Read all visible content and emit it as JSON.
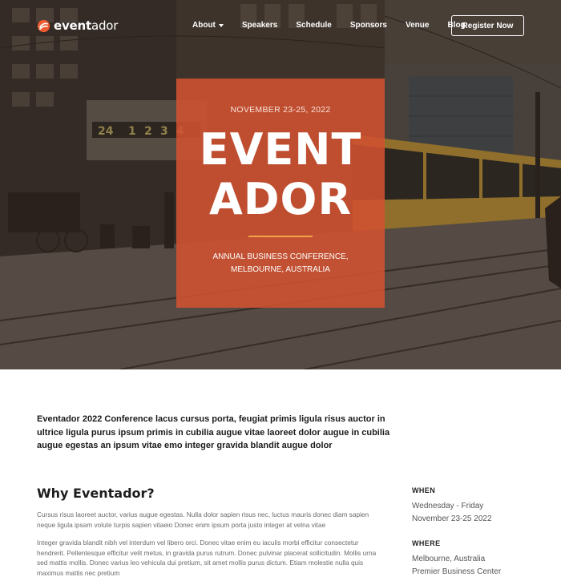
{
  "brand": {
    "name_bold": "event",
    "name_light": "ador",
    "accent": "#ee5a2f"
  },
  "nav": {
    "items": [
      {
        "label": "About",
        "has_dropdown": true
      },
      {
        "label": "Speakers"
      },
      {
        "label": "Schedule"
      },
      {
        "label": "Sponsors"
      },
      {
        "label": "Venue"
      },
      {
        "label": "Blog"
      }
    ],
    "register_label": "Register Now"
  },
  "hero": {
    "date": "NOVEMBER 23-25, 2022",
    "title_line1": "EVENT",
    "title_line2": "ADOR",
    "subtitle_line1": "ANNUAL BUSINESS CONFERENCE,",
    "subtitle_line2": "MELBOURNE, AUSTRALIA",
    "card_color": "#d15231",
    "divider_color": "#f2a34a"
  },
  "intro": "Eventador 2022 Conference lacus cursus porta, feugiat primis ligula risus auctor in ultrice ligula purus ipsum primis in cubilia augue vitae laoreet dolor augue in cubilia augue egestas an ipsum vitae emo integer gravida blandit augue dolor",
  "why": {
    "title": "Why Eventador?",
    "para1": "Cursus risus laoreet auctor, varius augue egestas. Nulla dolor sapien risus nec, luctus mauris donec diam sapien neque ligula ipsam volute turpis sapien vitaeio Donec enim ipsum porta justo integer at velna vitae",
    "para2": "Integer gravida blandit nibh vel interdum vel libero orci. Donec vitae enim eu iaculis morbi efficitur consectetur hendrerit. Pellentesque efficitur velit metus, in gravida purus rutrum. Donec pulvinar placerat sollicitudin. Mollis urna sed mattis mollis. Donec varius leo vehicula dui pretium, sit amet mollis purus dictum. Etiam molestie nulla quis maximus mattis nec pretium"
  },
  "details": {
    "when_label": "WHEN",
    "when_line1": "Wednesday - Friday",
    "when_line2": "November 23-25 2022",
    "where_label": "WHERE",
    "where_line1": "Melbourne, Australia",
    "where_line2": "Premier Business Center"
  }
}
